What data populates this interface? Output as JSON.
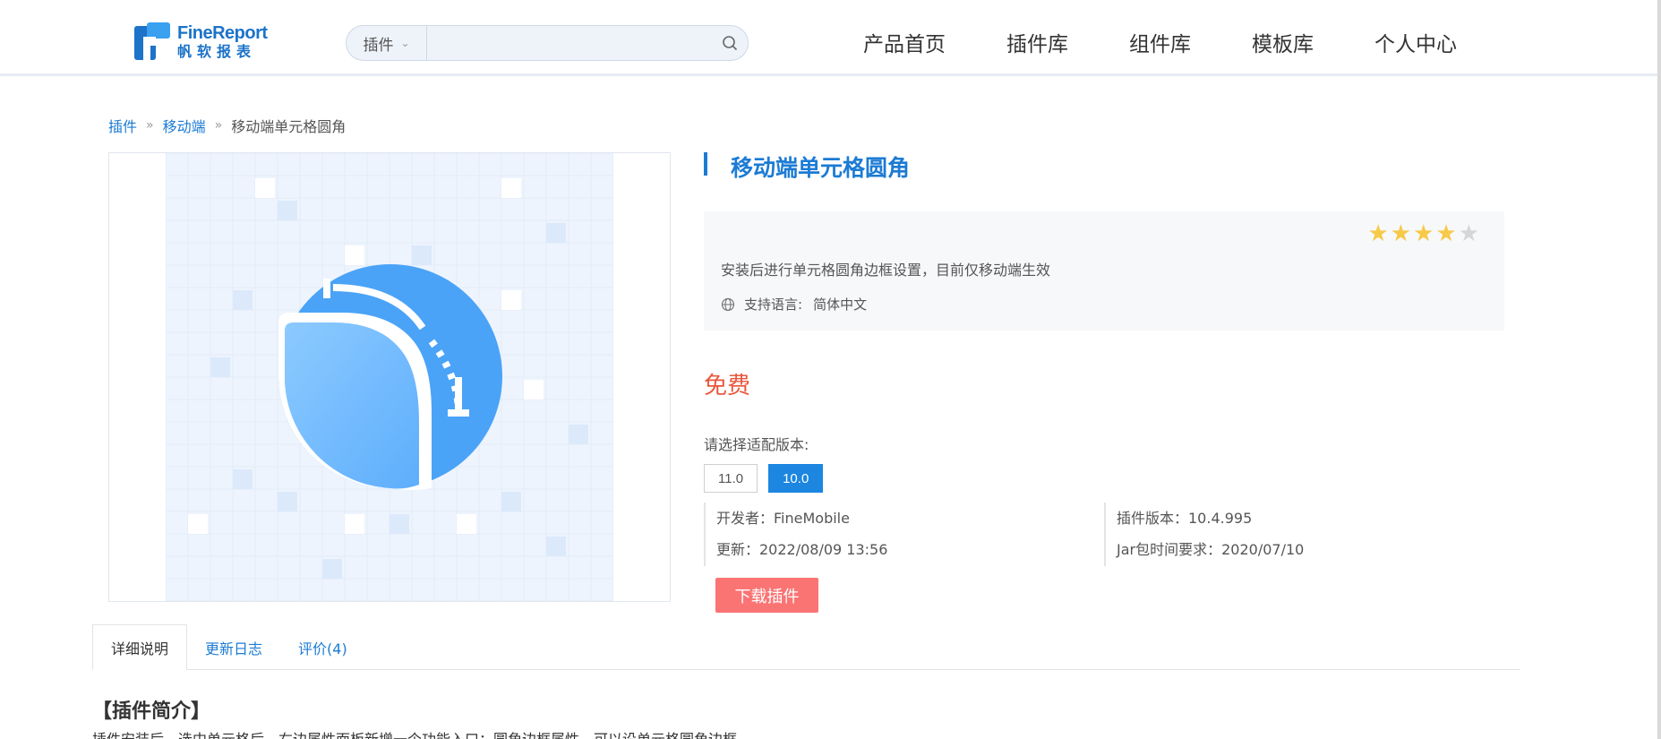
{
  "header": {
    "logo_en": "FineReport",
    "logo_cn": "帆软报表",
    "search": {
      "category": "插件",
      "placeholder": ""
    },
    "nav": [
      {
        "label": "产品首页"
      },
      {
        "label": "插件库"
      },
      {
        "label": "组件库"
      },
      {
        "label": "模板库"
      },
      {
        "label": "个人中心"
      }
    ]
  },
  "breadcrumb": {
    "items": [
      {
        "label": "插件"
      },
      {
        "label": "移动端"
      }
    ],
    "current": "移动端单元格圆角",
    "separator": "»"
  },
  "plugin": {
    "title": "移动端单元格圆角",
    "rating": 4,
    "rating_max": 5,
    "description": "安装后进行单元格圆角边框设置，目前仅移动端生效",
    "language_label": "支持语言:",
    "language_value": "简体中文",
    "price": "免费",
    "version_label": "请选择适配版本:",
    "versions": [
      {
        "label": "11.0",
        "active": false
      },
      {
        "label": "10.0",
        "active": true
      }
    ],
    "developer": "开发者：FineMobile",
    "updated": "更新：2022/08/09 13:56",
    "plugin_version": "插件版本：10.4.995",
    "jar_requirement": "Jar包时间要求：2020/07/10",
    "download_label": "下载插件"
  },
  "tabs": [
    {
      "label": "详细说明",
      "active": true
    },
    {
      "label": "更新日志",
      "active": false
    },
    {
      "label": "评价(4)",
      "active": false
    }
  ],
  "intro": {
    "title": "【插件简介】",
    "text": "插件安装后，选中单元格后，右边属性面板新增一个功能入口：圆角边框属性，可以设单元格圆角边框"
  },
  "colors": {
    "brand": "#1c7bd4",
    "price": "#e8573c",
    "download": "#fa7474",
    "active_version": "#1c86e0",
    "star_on": "#f7c948",
    "star_off": "#d6d6d6"
  }
}
